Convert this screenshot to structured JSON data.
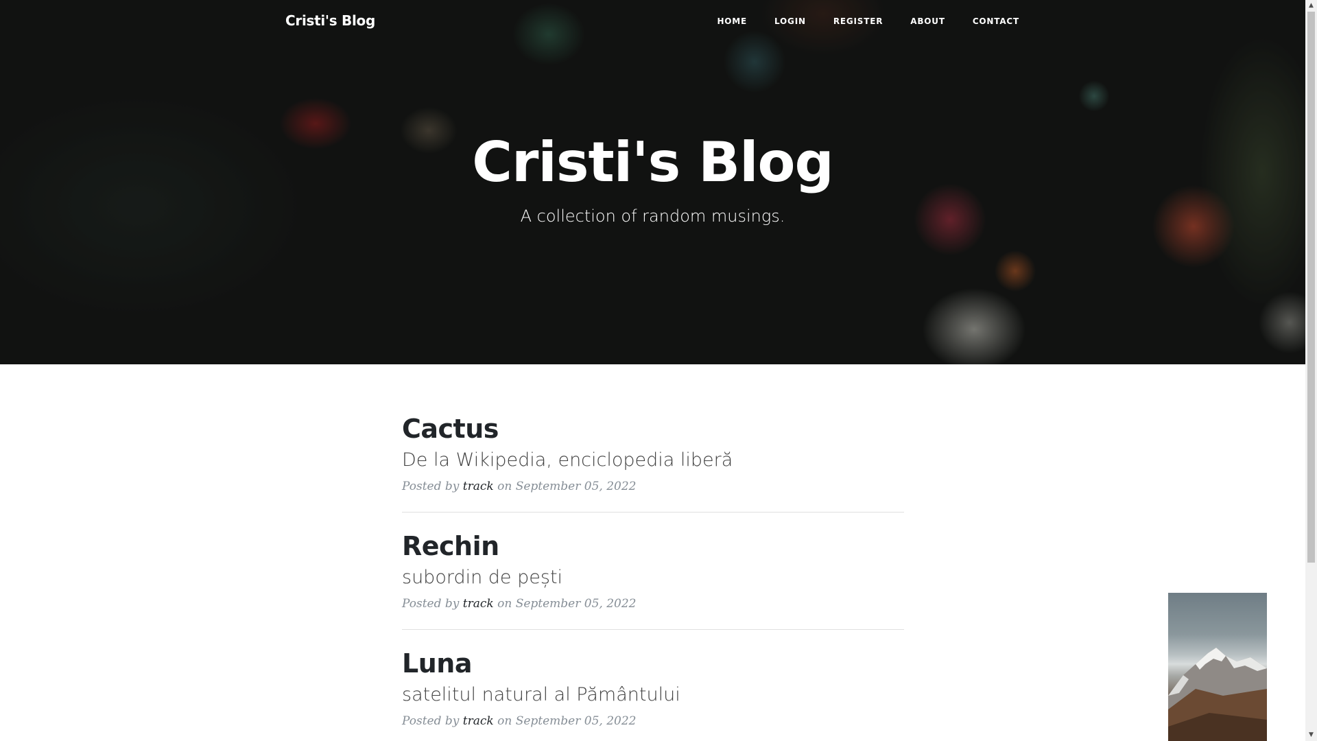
{
  "nav": {
    "brand": "Cristi's Blog",
    "links": [
      "HOME",
      "LOGIN",
      "REGISTER",
      "ABOUT",
      "CONTACT"
    ]
  },
  "hero": {
    "title": "Cristi's Blog",
    "subtitle": "A collection of random musings."
  },
  "posts": [
    {
      "title": "Cactus",
      "subtitle": "De la Wikipedia, enciclopedia liberă",
      "meta_prefix": "Posted by",
      "author": "track",
      "meta_suffix": "on September 05, 2022"
    },
    {
      "title": "Rechin",
      "subtitle": "subordin de pești",
      "meta_prefix": "Posted by",
      "author": "track",
      "meta_suffix": "on September 05, 2022"
    },
    {
      "title": "Luna",
      "subtitle": "satelitul natural al Pământului",
      "meta_prefix": "Posted by",
      "author": "track",
      "meta_suffix": "on September 05, 2022"
    }
  ],
  "colors": {
    "heading": "#212529",
    "subtitle": "#404040",
    "meta": "#868e96",
    "divider": "#e0e0e0"
  },
  "icons": {
    "scroll_up": "triangle-up-icon",
    "scroll_down": "triangle-down-icon"
  }
}
